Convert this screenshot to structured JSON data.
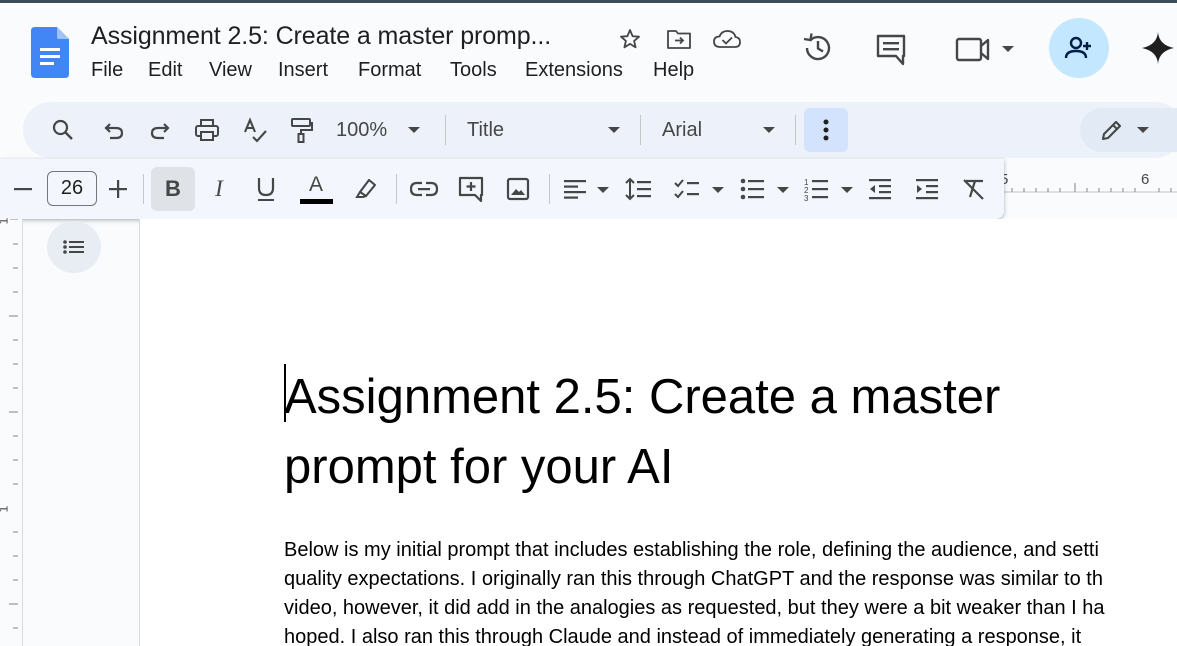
{
  "header": {
    "doc_title": "Assignment 2.5: Create a master promp...",
    "menu": [
      "File",
      "Edit",
      "View",
      "Insert",
      "Format",
      "Tools",
      "Extensions",
      "Help"
    ]
  },
  "toolbar": {
    "zoom": "100%",
    "style": "Title",
    "font": "Arial"
  },
  "format_bar": {
    "font_size": "26",
    "text_color": "#000000"
  },
  "ruler": {
    "top_label": "6",
    "left_label_1": "1",
    "left_label_2": "1"
  },
  "document": {
    "title_line1": "Assignment 2.5: Create a master",
    "title_line2": "prompt for your AI",
    "paragraph_lines": [
      "Below is my initial prompt that includes establishing the role, defining the audience, and setti",
      "quality expectations. I originally ran this through ChatGPT and the response was similar to th",
      "video, however, it did add in the analogies as requested, but they were a bit weaker than I ha",
      "hoped. I also ran this through Claude and instead of immediately generating a response, it"
    ]
  },
  "colors": {
    "accent": "#1a73e8",
    "share_bg": "#c2e7ff",
    "toolbar_bg": "#edf2fa"
  }
}
